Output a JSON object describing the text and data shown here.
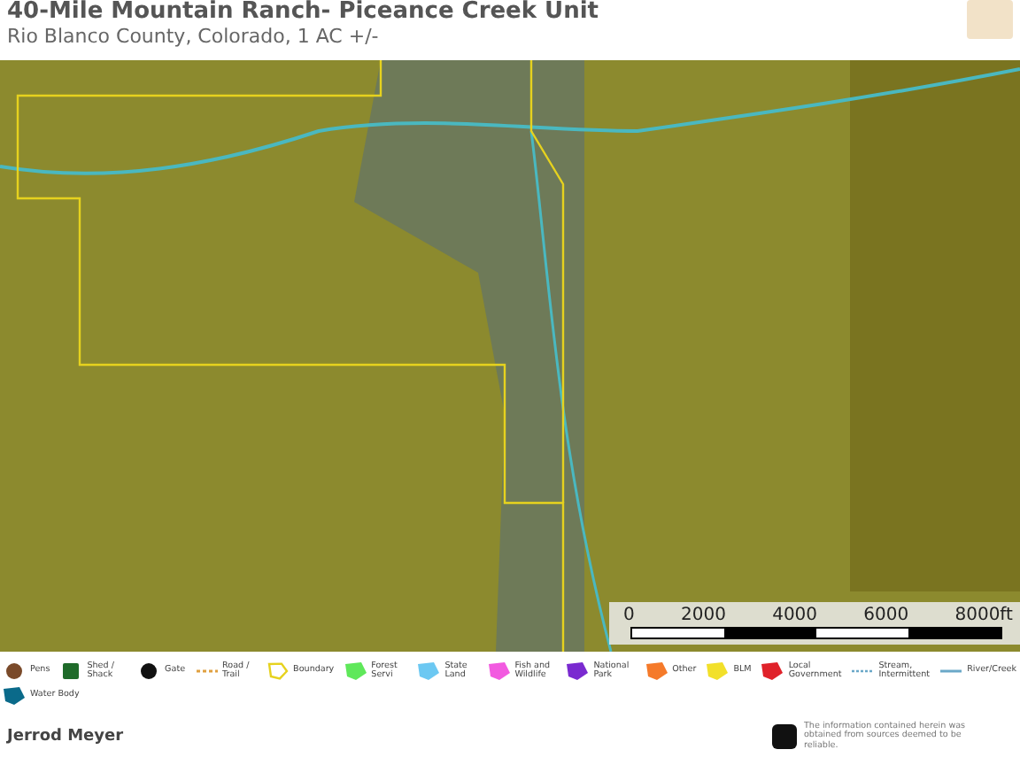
{
  "header": {
    "title": "40-Mile Mountain Ranch- Piceance Creek Unit",
    "subtitle": "Rio Blanco County, Colorado, 1 AC +/-"
  },
  "map": {
    "scale_labels": [
      "0",
      "2000",
      "4000",
      "6000",
      "8000ft"
    ]
  },
  "legend": {
    "rows": [
      {
        "items": [
          {
            "kind": "pin",
            "label": "Pens",
            "color": "#7a4a2a"
          },
          {
            "kind": "shed",
            "label": "Shed / Shack",
            "color": "#1f6b2a"
          },
          {
            "kind": "gate",
            "label": "Gate",
            "color": "#111111"
          },
          {
            "kind": "dashed",
            "label": "Road / Trail",
            "color": "#e0a040"
          },
          {
            "kind": "outline",
            "label": "Boundary",
            "color": "#e6d21e"
          },
          {
            "kind": "area",
            "label": "Forest Servi",
            "color": "#5fe85a"
          },
          {
            "kind": "area",
            "label": "State Land",
            "color": "#6cc8f2"
          },
          {
            "kind": "area",
            "label": "Fish and Wildlife",
            "color": "#f25ae0"
          },
          {
            "kind": "area",
            "label": "National Park",
            "color": "#7a2ad0"
          },
          {
            "kind": "area",
            "label": "Other",
            "color": "#f57a2a"
          },
          {
            "kind": "area",
            "label": "BLM",
            "color": "#f2e02a"
          },
          {
            "kind": "area",
            "label": "Local Government",
            "color": "#e0222a"
          },
          {
            "kind": "stream",
            "label": "Stream, Intermittent",
            "color": "#6aa8c8"
          },
          {
            "kind": "river",
            "label": "River/Creek",
            "color": "#6aa8c8"
          }
        ]
      },
      {
        "items": [
          {
            "kind": "area",
            "label": "Water Body",
            "color": "#0a6a8a"
          }
        ]
      }
    ]
  },
  "footer": {
    "agent": "Jerrod Meyer",
    "disclaimer": "The information contained herein was obtained from sources deemed to be reliable."
  }
}
